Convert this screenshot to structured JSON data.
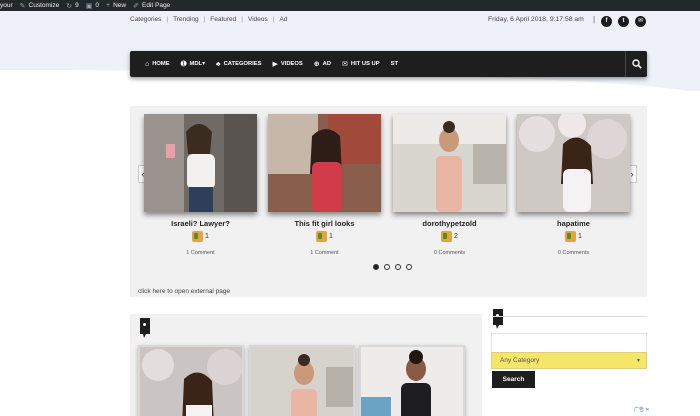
{
  "admin_bar": {
    "site_label": "your",
    "customize": "Customize",
    "updates_count": "9",
    "comments_count": "0",
    "new_label": "New",
    "edit_page": "Edit Page"
  },
  "top_nav": {
    "items": [
      "Categories",
      "Trending",
      "Featured",
      "Videos",
      "Ad"
    ]
  },
  "date_text": "Friday, 6 April 2018, 9:17:58 am",
  "social": {
    "facebook": "f",
    "twitter": "t",
    "email": "✉"
  },
  "main_nav": {
    "items": [
      {
        "label": "HOME",
        "icon": "home-icon",
        "glyph": "⌂"
      },
      {
        "label": "MDL",
        "icon": "arrow-circle-icon",
        "glyph": "➊"
      },
      {
        "label": "CATEGORIES",
        "icon": "users-icon",
        "glyph": "♣"
      },
      {
        "label": "VIDEOS",
        "icon": "video-camera-icon",
        "glyph": "▶"
      },
      {
        "label": "AD",
        "icon": "plus-circle-icon",
        "glyph": "⊕"
      },
      {
        "label": "HIT US UP",
        "icon": "envelope-icon",
        "glyph": "✉"
      },
      {
        "label": "ST",
        "icon": "",
        "glyph": ""
      }
    ],
    "mdl_caret": "▾"
  },
  "slider": {
    "slides": [
      {
        "title": "Israeli? Lawyer?",
        "likes": "1",
        "comments": "1 Comment"
      },
      {
        "title": "This fit girl looks",
        "likes": "1",
        "comments": "1 Comment"
      },
      {
        "title": "dorothypetzold",
        "likes": "2",
        "comments": "0 Comments"
      },
      {
        "title": "hapatime",
        "likes": "1",
        "comments": "0 Comments"
      }
    ],
    "external_link": "click here to open external page"
  },
  "sidebar": {
    "category_select": "Any Category",
    "search_button": "Search"
  },
  "ad_choices": "AdChoices"
}
